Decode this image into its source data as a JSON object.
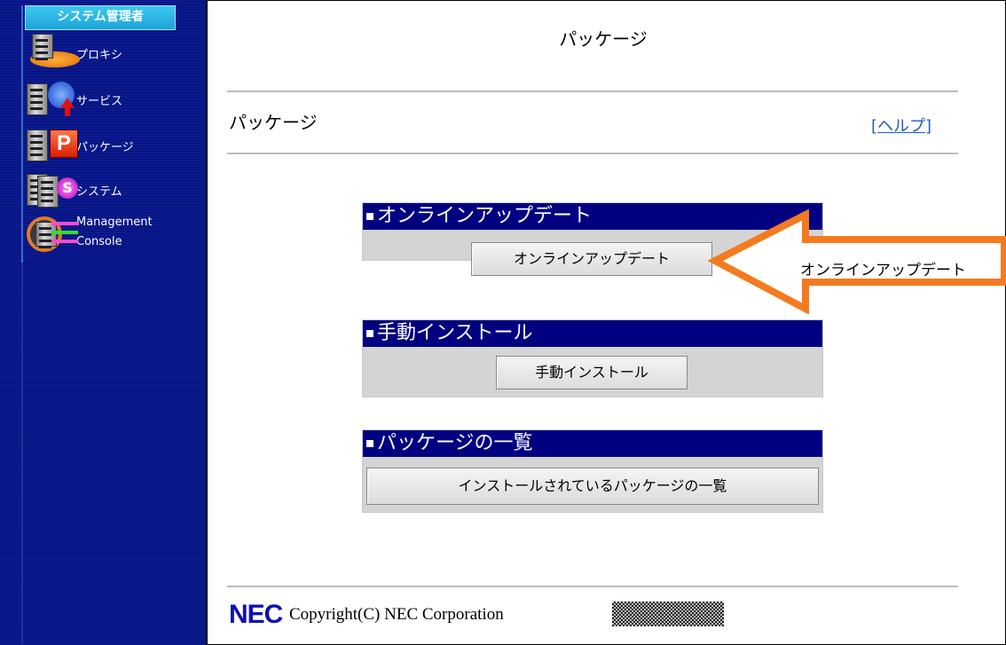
{
  "sidebar": {
    "title": "システム管理者",
    "items": [
      {
        "label": "プロキシ",
        "icon": "proxy-icon"
      },
      {
        "label": "サービス",
        "icon": "service-icon"
      },
      {
        "label": "パッケージ",
        "icon": "package-icon"
      },
      {
        "label": "システム",
        "icon": "system-icon"
      },
      {
        "label": "Management",
        "label2": "Console",
        "icon": "management-console-icon"
      }
    ]
  },
  "main": {
    "title": "パッケージ",
    "subtitle": "パッケージ",
    "help_link": "[ヘルプ]",
    "sections": [
      {
        "heading": "オンラインアップデート",
        "button": "オンラインアップデート"
      },
      {
        "heading": "手動インストール",
        "button": "手動インストール"
      },
      {
        "heading": "パッケージの一覧",
        "button": "インストールされているパッケージの一覧"
      }
    ]
  },
  "annotation": {
    "label": "オンラインアップデート",
    "arrow_color": "#f47a1f"
  },
  "footer": {
    "logo": "NEC",
    "copyright": "Copyright(C) NEC Corporation"
  },
  "colors": {
    "sidebar_bg": "#0a1a8c",
    "panel_header": "#000080",
    "panel_bg": "#d4d4d4",
    "link": "#1f5fbf"
  }
}
